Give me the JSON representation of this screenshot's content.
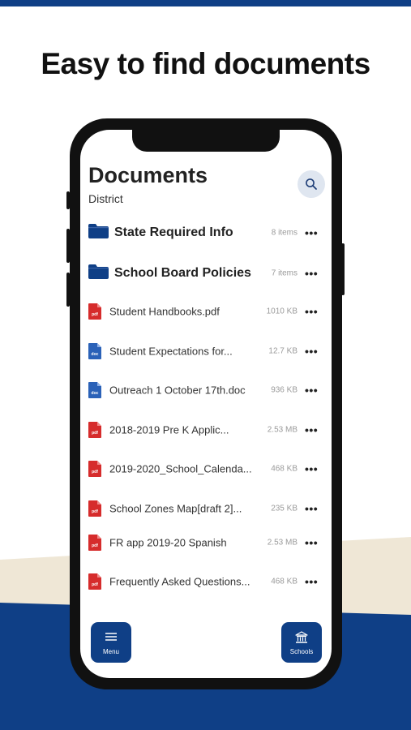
{
  "headline": "Easy to find documents",
  "colors": {
    "brand_blue": "#0f3f86",
    "cream": "#efe7d6",
    "pdf_red": "#d62c2c",
    "doc_blue": "#2b62b8"
  },
  "header": {
    "title": "Documents",
    "subtitle": "District",
    "search_icon": "search-icon"
  },
  "folders": [
    {
      "name": "State Required Info",
      "meta": "8 items",
      "icon": "folder-icon"
    },
    {
      "name": "School Board Policies",
      "meta": "7 items",
      "icon": "folder-icon"
    }
  ],
  "files": [
    {
      "name": "Student Handbooks.pdf",
      "meta": "1010 KB",
      "ext": "pdf"
    },
    {
      "name": "Student Expectations for...",
      "meta": "12.7 KB",
      "ext": "doc"
    },
    {
      "name": "Outreach 1 October 17th.doc",
      "meta": "936 KB",
      "ext": "doc"
    },
    {
      "name": "2018-2019 Pre K Applic...",
      "meta": "2.53 MB",
      "ext": "pdf"
    },
    {
      "name": "2019-2020_School_Calenda...",
      "meta": "468 KB",
      "ext": "pdf"
    },
    {
      "name": "School Zones Map[draft 2]...",
      "meta": "235 KB",
      "ext": "pdf"
    },
    {
      "name": "FR app 2019-20 Spanish",
      "meta": "2.53 MB",
      "ext": "pdf"
    },
    {
      "name": "Frequently Asked Questions...",
      "meta": "468 KB",
      "ext": "pdf"
    }
  ],
  "more_label": "•••",
  "nav": {
    "menu_label": "Menu",
    "schools_label": "Schools"
  }
}
